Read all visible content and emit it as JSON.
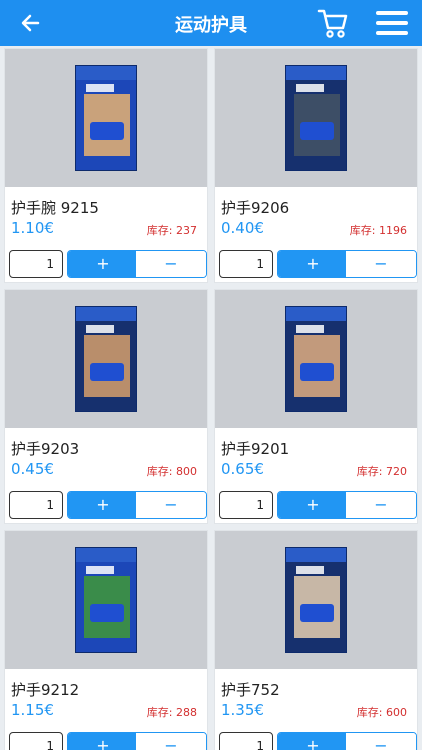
{
  "header": {
    "title": "运动护具",
    "back_icon": "back-arrow-icon",
    "cart_icon": "cart-icon",
    "menu_icon": "hamburger-menu-icon"
  },
  "stock_label": "库存:",
  "products": [
    {
      "name": "护手腕 9215",
      "price": "1.10€",
      "stock": "库存: 237",
      "qty": "1",
      "plus": "+",
      "minus": "−",
      "box_label": "YECHUN"
    },
    {
      "name": "护手9206",
      "price": "0.40€",
      "stock": "库存: 1196",
      "qty": "1",
      "plus": "+",
      "minus": "−",
      "box_label": "WRIST"
    },
    {
      "name": "护手9203",
      "price": "0.45€",
      "stock": "库存: 800",
      "qty": "1",
      "plus": "+",
      "minus": "−",
      "box_label": "PALM"
    },
    {
      "name": "护手9201",
      "price": "0.65€",
      "stock": "库存: 720",
      "qty": "1",
      "plus": "+",
      "minus": "−",
      "box_label": "ELBOW"
    },
    {
      "name": "护手9212",
      "price": "1.15€",
      "stock": "库存: 288",
      "qty": "1",
      "plus": "+",
      "minus": "−",
      "box_label": "YECHUN"
    },
    {
      "name": "护手752",
      "price": "1.35€",
      "stock": "库存: 600",
      "qty": "1",
      "plus": "+",
      "minus": "−",
      "box_label": "YC SUPPORT"
    }
  ],
  "colors": {
    "accent": "#2196f3",
    "header": "#1e8ff0",
    "stock": "#d32f2f"
  }
}
